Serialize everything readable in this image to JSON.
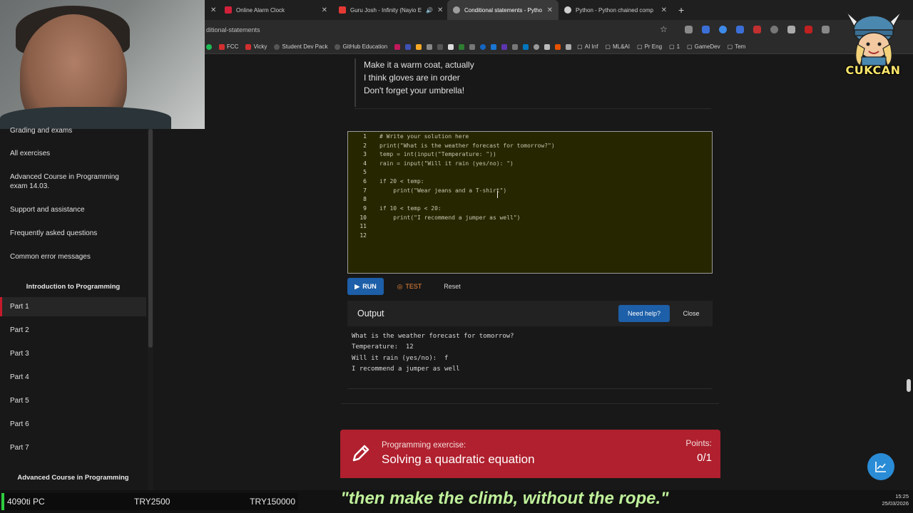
{
  "browser": {
    "tabs": [
      {
        "label": "Online Alarm Clock",
        "color": "#d2203a"
      },
      {
        "label": "Guru Josh - Infinity (Nayio E",
        "color": "#e53935"
      },
      {
        "label": "Conditional statements - Pytho",
        "color": "#9e9e9e",
        "active": true
      },
      {
        "label": "Python - Python chained comp",
        "color": "#cfcfcf"
      }
    ],
    "new_tab": "+",
    "url": "ditional-statements",
    "bookmarks": [
      "FCC",
      "Vicky",
      "Student Dev Pack",
      "GitHub Education",
      "AI Inf",
      "ML&AI",
      "Pr Eng",
      "1",
      "GameDev",
      "Tem"
    ]
  },
  "sidebar": {
    "items": [
      {
        "label": "Grading and exams"
      },
      {
        "label": "All exercises"
      },
      {
        "label": "Advanced Course in Programming exam 14.03."
      },
      {
        "label": "Support and assistance"
      },
      {
        "label": "Frequently asked questions"
      },
      {
        "label": "Common error messages"
      }
    ],
    "section1": "Introduction to Programming",
    "parts": [
      "Part 1",
      "Part 2",
      "Part 3",
      "Part 4",
      "Part 5",
      "Part 6",
      "Part 7"
    ],
    "section2": "Advanced Course in Programming"
  },
  "example_output": [
    "Make it a warm coat, actually",
    "I think gloves are in order",
    "Don't forget your umbrella!"
  ],
  "editor": {
    "line_numbers": [
      "1",
      "2",
      "3",
      "4",
      "5",
      "6",
      "7",
      "8",
      "9",
      "10",
      "11",
      "12"
    ],
    "lines": [
      "# Write your solution here",
      "print(\"What is the weather forecast for tomorrow?\")",
      "temp = int(input(\"Temperature: \"))",
      "rain = input(\"Will it rain (yes/no): \")",
      "",
      "if 20 < temp:",
      "    print(\"Wear jeans and a T-shirt\")",
      "",
      "if 10 < temp < 20:",
      "    print(\"I recommend a jumper as well\")",
      "",
      ""
    ]
  },
  "buttons": {
    "run": "RUN",
    "test": "TEST",
    "reset": "Reset",
    "help": "Need help?",
    "close": "Close"
  },
  "output": {
    "title": "Output",
    "lines": [
      "What is the weather forecast for tomorrow?",
      "Temperature:  12",
      "Will it rain (yes/no):  f",
      "I recommend a jumper as well"
    ]
  },
  "exercise": {
    "kind": "Programming exercise:",
    "title": "Solving a quadratic equation",
    "points_label": "Points:",
    "points": "0/1"
  },
  "mascot": {
    "name": "CUKCAN"
  },
  "stream": {
    "pc": "4090ti PC",
    "goal1": "TRY2500",
    "goal2": "TRY150000",
    "subtitle": "\"then make the climb, without the rope.\""
  },
  "clock": {
    "time": "15:25",
    "date": "25/03/2026"
  },
  "colors": {
    "accent": "#1d5fa8",
    "exercise_red": "#b0202e",
    "active_part": "#c61a2c"
  }
}
